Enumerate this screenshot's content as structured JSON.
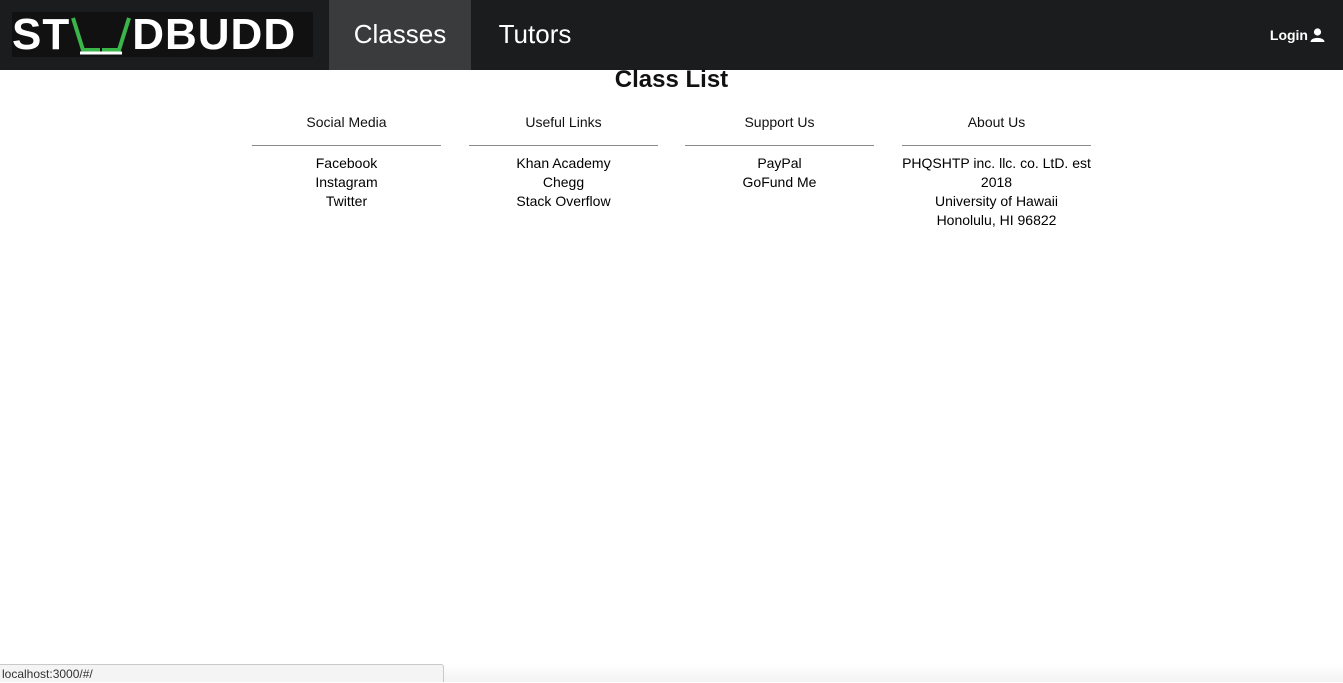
{
  "header": {
    "logo": {
      "part1": "ST",
      "part2": "DBUDD"
    },
    "nav": [
      {
        "label": "Classes",
        "active": true
      },
      {
        "label": "Tutors",
        "active": false
      }
    ],
    "login_label": "Login"
  },
  "main": {
    "title": "Class List"
  },
  "footer": {
    "columns": [
      {
        "heading": "Social Media",
        "items": [
          "Facebook",
          "Instagram",
          "Twitter"
        ]
      },
      {
        "heading": "Useful Links",
        "items": [
          "Khan Academy",
          "Chegg",
          "Stack Overflow"
        ]
      },
      {
        "heading": "Support Us",
        "items": [
          "PayPal",
          "GoFund Me"
        ]
      },
      {
        "heading": "About Us",
        "items": [
          "PHQSHTP inc. llc. co. LtD. est",
          "2018",
          "University of Hawaii",
          "Honolulu, HI 96822"
        ]
      }
    ]
  },
  "status_bar": {
    "url": "localhost:3000/#/"
  },
  "colors": {
    "nav_bg": "#1b1c1d",
    "nav_active_bg": "#3a3b3c",
    "logo_accent": "#39b54a"
  }
}
